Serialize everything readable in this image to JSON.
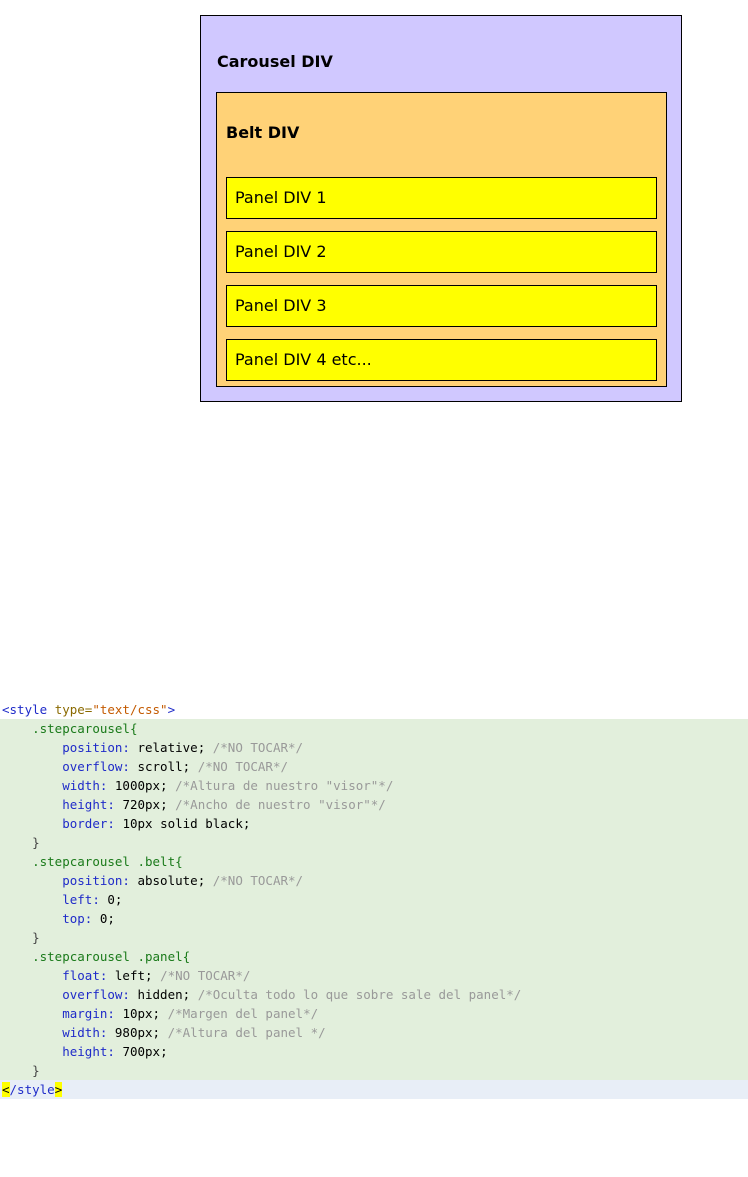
{
  "diagram": {
    "carousel_label": "Carousel DIV",
    "belt_label": "Belt DIV",
    "panels": [
      "Panel DIV 1",
      "Panel DIV 2",
      "Panel DIV 3",
      "Panel DIV 4 etc..."
    ]
  },
  "code": {
    "open_tag": "<style type=\"text/css\">",
    "lines": [
      {
        "indent": "    ",
        "selector": ".stepcarousel{"
      },
      {
        "indent": "        ",
        "prop": "position",
        "value": "relative;",
        "comment": "/*NO TOCAR*/"
      },
      {
        "indent": "        ",
        "prop": "overflow",
        "value": "scroll;",
        "comment": "/*NO TOCAR*/"
      },
      {
        "indent": "        ",
        "prop": "width",
        "value": "1000px;",
        "comment": "/*Altura de nuestro \"visor\"*/"
      },
      {
        "indent": "        ",
        "prop": "height",
        "value": "720px;",
        "comment": "/*Ancho de nuestro \"visor\"*/"
      },
      {
        "indent": "        ",
        "prop": "border",
        "value": "10px solid black;",
        "comment": ""
      },
      {
        "indent": "    ",
        "brace": "}"
      },
      {
        "indent": "    ",
        "selector": ".stepcarousel .belt{"
      },
      {
        "indent": "        ",
        "prop": "position",
        "value": "absolute;",
        "comment": "/*NO TOCAR*/"
      },
      {
        "indent": "        ",
        "prop": "left",
        "value": "0;",
        "comment": ""
      },
      {
        "indent": "        ",
        "prop": "top",
        "value": "0;",
        "comment": ""
      },
      {
        "indent": "    ",
        "brace": "}"
      },
      {
        "indent": "    ",
        "selector": ".stepcarousel .panel{"
      },
      {
        "indent": "        ",
        "prop": "float",
        "value": "left;",
        "comment": "/*NO TOCAR*/"
      },
      {
        "indent": "        ",
        "prop": "overflow",
        "value": "hidden;",
        "comment": "/*Oculta todo lo que sobre sale del panel*/"
      },
      {
        "indent": "        ",
        "prop": "margin",
        "value": "10px;",
        "comment": "/*Margen del panel*/"
      },
      {
        "indent": "        ",
        "prop": "width",
        "value": "980px;",
        "comment": "/*Altura del panel */"
      },
      {
        "indent": "        ",
        "prop": "height",
        "value": "700px;",
        "comment": ""
      },
      {
        "indent": "    ",
        "brace": "}"
      }
    ],
    "close_tag": "</style>"
  }
}
